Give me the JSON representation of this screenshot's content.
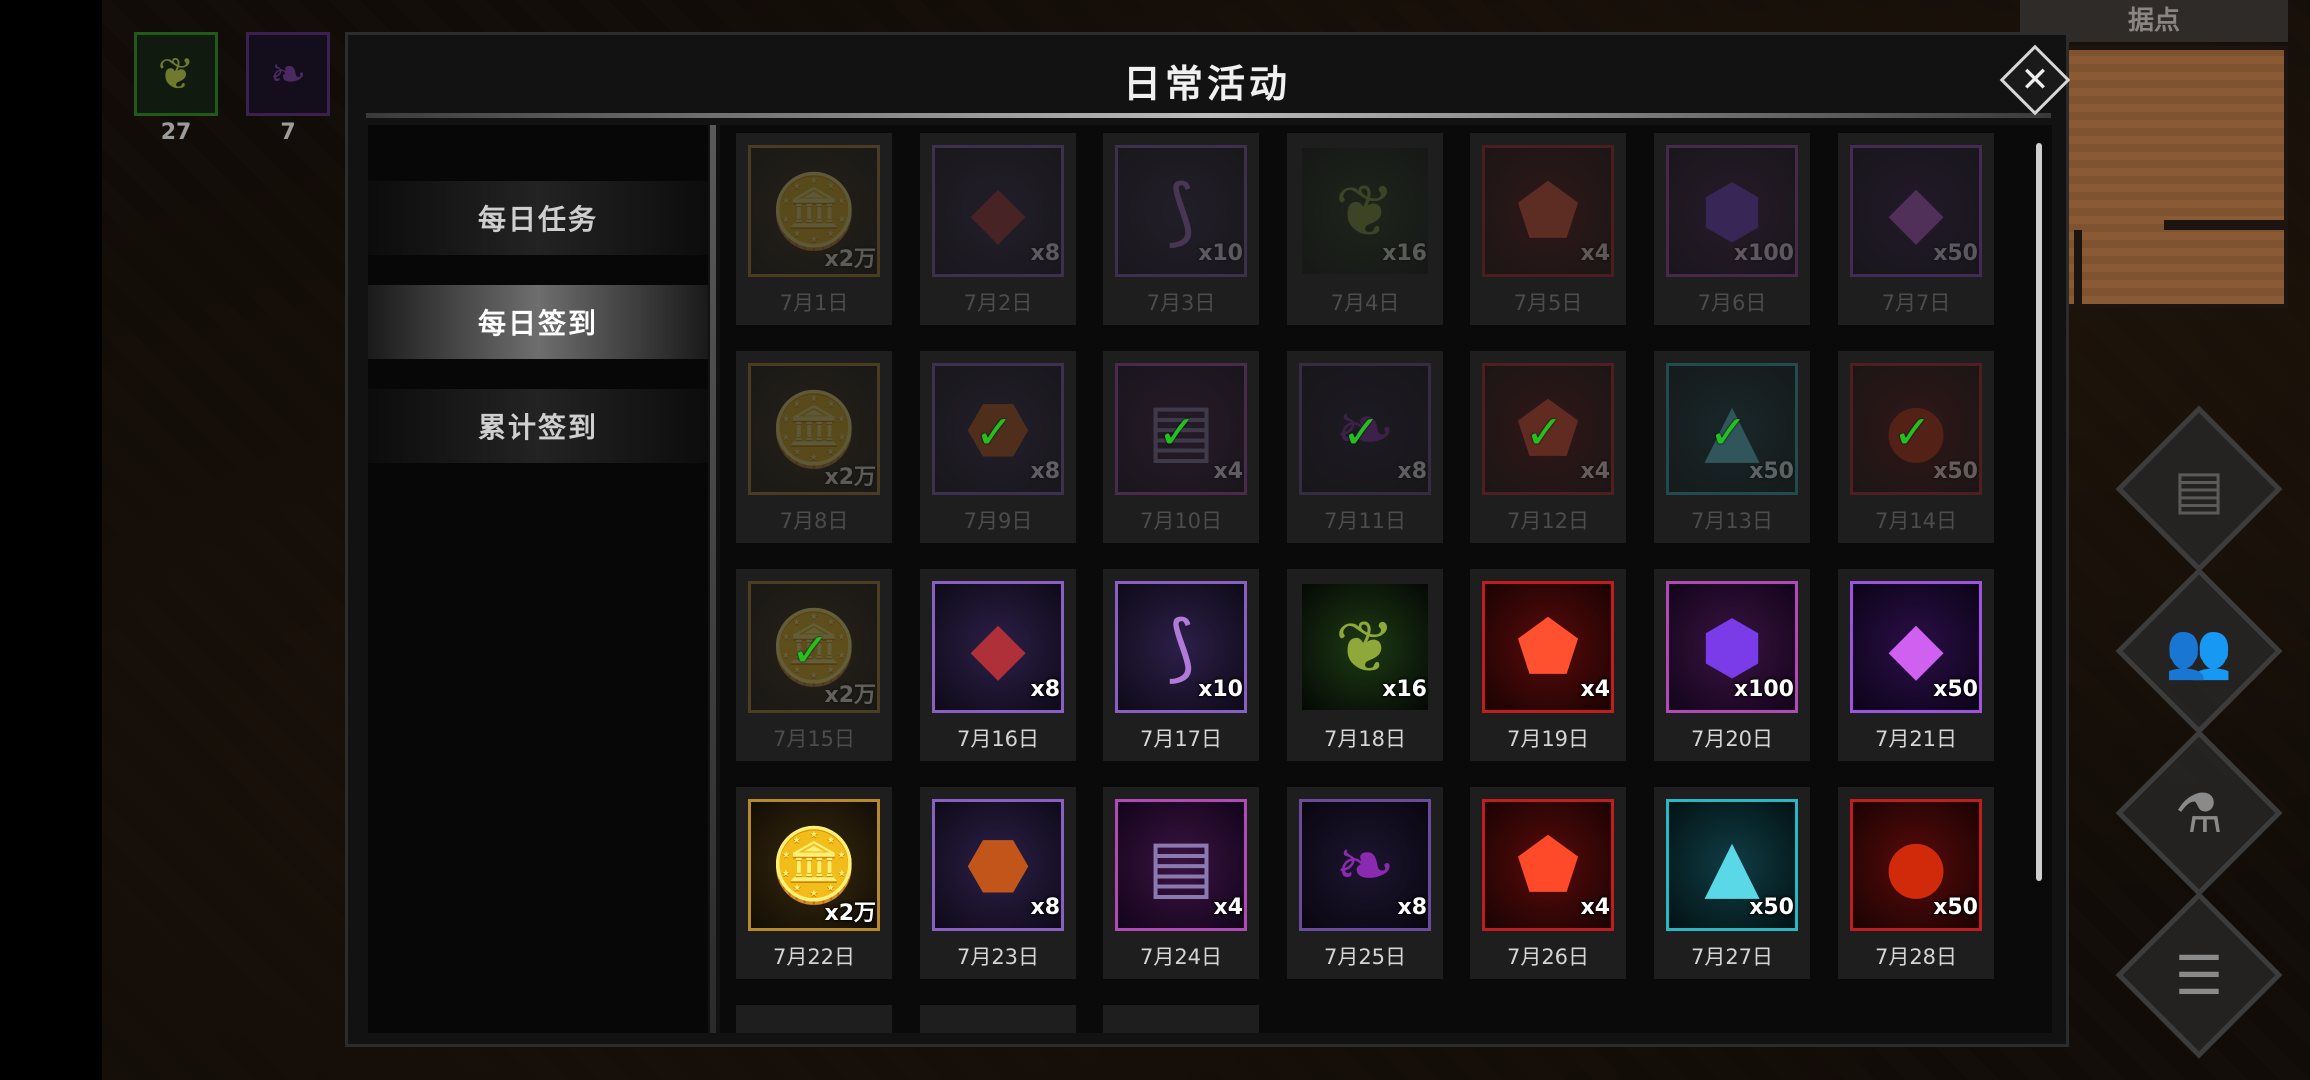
{
  "inventory": [
    {
      "icon": "seed-icon",
      "count": "27"
    },
    {
      "icon": "feather-icon",
      "count": "7"
    }
  ],
  "minimap": {
    "title": "据点"
  },
  "side_buttons": [
    "scroll-icon",
    "party-icon",
    "potion-icon",
    "menu-icon"
  ],
  "dialog": {
    "title": "日常活动",
    "close_glyph": "✕"
  },
  "tabs": [
    {
      "label": "每日任务",
      "active": false
    },
    {
      "label": "每日签到",
      "active": true
    },
    {
      "label": "累计签到",
      "active": false
    }
  ],
  "check_glyph": "✓",
  "rewards": [
    {
      "day": "7月1日",
      "qty": "x2万",
      "item": "gold-coins-icon",
      "rarity": "gold",
      "state": "past"
    },
    {
      "day": "7月2日",
      "qty": "x8",
      "item": "red-ore-icon",
      "rarity": "purple",
      "state": "past"
    },
    {
      "day": "7月3日",
      "qty": "x10",
      "item": "purple-claws-icon",
      "rarity": "purple",
      "state": "past"
    },
    {
      "day": "7月4日",
      "qty": "x16",
      "item": "green-seed-icon",
      "rarity": "green",
      "state": "past"
    },
    {
      "day": "7月5日",
      "qty": "x4",
      "item": "fire-crystal-icon",
      "rarity": "red",
      "state": "past"
    },
    {
      "day": "7月6日",
      "qty": "x100",
      "item": "purple-gem-icon",
      "rarity": "magenta",
      "state": "past"
    },
    {
      "day": "7月7日",
      "qty": "x50",
      "item": "violet-diamond-icon",
      "rarity": "violet",
      "state": "past"
    },
    {
      "day": "7月8日",
      "qty": "x2万",
      "item": "gold-coins-icon",
      "rarity": "gold",
      "state": "past"
    },
    {
      "day": "7月9日",
      "qty": "x8",
      "item": "amber-crystal-icon",
      "rarity": "purple",
      "state": "claimed"
    },
    {
      "day": "7月10日",
      "qty": "x4",
      "item": "spell-book-icon",
      "rarity": "magenta",
      "state": "claimed"
    },
    {
      "day": "7月11日",
      "qty": "x8",
      "item": "dark-feather-icon",
      "rarity": "darkp",
      "state": "claimed"
    },
    {
      "day": "7月12日",
      "qty": "x4",
      "item": "ruby-gem-icon",
      "rarity": "red",
      "state": "claimed"
    },
    {
      "day": "7月13日",
      "qty": "x50",
      "item": "ice-pyramid-icon",
      "rarity": "cyan",
      "state": "claimed"
    },
    {
      "day": "7月14日",
      "qty": "x50",
      "item": "fire-orb-icon",
      "rarity": "red",
      "state": "claimed"
    },
    {
      "day": "7月15日",
      "qty": "x2万",
      "item": "gold-coins-icon",
      "rarity": "gold",
      "state": "claimed"
    },
    {
      "day": "7月16日",
      "qty": "x8",
      "item": "red-ore-icon",
      "rarity": "purple",
      "state": "available"
    },
    {
      "day": "7月17日",
      "qty": "x10",
      "item": "purple-claws-icon",
      "rarity": "purple",
      "state": "available"
    },
    {
      "day": "7月18日",
      "qty": "x16",
      "item": "green-seed-icon",
      "rarity": "green",
      "state": "available"
    },
    {
      "day": "7月19日",
      "qty": "x4",
      "item": "fire-crystal-icon",
      "rarity": "red",
      "state": "available"
    },
    {
      "day": "7月20日",
      "qty": "x100",
      "item": "purple-gem-icon",
      "rarity": "magenta",
      "state": "available"
    },
    {
      "day": "7月21日",
      "qty": "x50",
      "item": "violet-diamond-icon",
      "rarity": "violet",
      "state": "available"
    },
    {
      "day": "7月22日",
      "qty": "x2万",
      "item": "gold-coins-icon",
      "rarity": "gold",
      "state": "available"
    },
    {
      "day": "7月23日",
      "qty": "x8",
      "item": "amber-crystal-icon",
      "rarity": "purple",
      "state": "available"
    },
    {
      "day": "7月24日",
      "qty": "x4",
      "item": "spell-book-icon",
      "rarity": "magenta",
      "state": "available"
    },
    {
      "day": "7月25日",
      "qty": "x8",
      "item": "dark-feather-icon",
      "rarity": "darkp",
      "state": "available"
    },
    {
      "day": "7月26日",
      "qty": "x4",
      "item": "ruby-gem-icon",
      "rarity": "red",
      "state": "available"
    },
    {
      "day": "7月27日",
      "qty": "x50",
      "item": "ice-pyramid-icon",
      "rarity": "cyan",
      "state": "available"
    },
    {
      "day": "7月28日",
      "qty": "x50",
      "item": "fire-orb-icon",
      "rarity": "red",
      "state": "available"
    }
  ],
  "icon_glyphs": {
    "gold-coins-icon": {
      "glyph": "🪙",
      "color": "#e0b030"
    },
    "red-ore-icon": {
      "glyph": "◆",
      "color": "#b0303a"
    },
    "purple-claws-icon": {
      "glyph": "⟆",
      "color": "#b07ad8"
    },
    "green-seed-icon": {
      "glyph": "❦",
      "color": "#8fa83a"
    },
    "fire-crystal-icon": {
      "glyph": "⬟",
      "color": "#ff5030"
    },
    "purple-gem-icon": {
      "glyph": "⬢",
      "color": "#7a3ce8"
    },
    "violet-diamond-icon": {
      "glyph": "◆",
      "color": "#d060f0"
    },
    "amber-crystal-icon": {
      "glyph": "⬣",
      "color": "#c2561a"
    },
    "spell-book-icon": {
      "glyph": "▤",
      "color": "#8a7ab0"
    },
    "dark-feather-icon": {
      "glyph": "❧",
      "color": "#8a2ab0"
    },
    "ruby-gem-icon": {
      "glyph": "⬟",
      "color": "#ff4a2a"
    },
    "ice-pyramid-icon": {
      "glyph": "▲",
      "color": "#5ad8e8"
    },
    "fire-orb-icon": {
      "glyph": "●",
      "color": "#d02a0a"
    }
  }
}
